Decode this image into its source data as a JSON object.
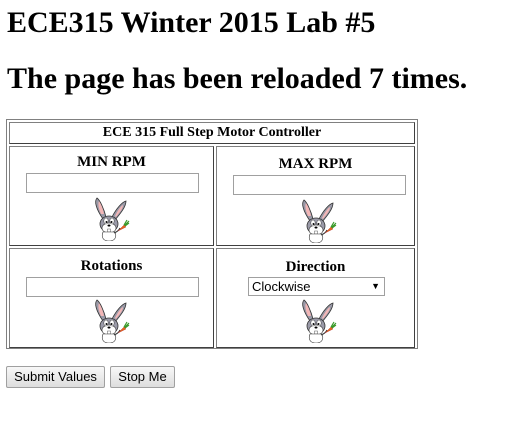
{
  "headings": {
    "lab_title": "ECE315 Winter 2015 Lab #5",
    "reload_text": "The page has been reloaded 7 times."
  },
  "controller": {
    "title": "ECE 315 Full Step Motor Controller",
    "min_rpm": {
      "label": "MIN RPM",
      "value": ""
    },
    "max_rpm": {
      "label": "MAX RPM",
      "value": ""
    },
    "rotations": {
      "label": "Rotations",
      "value": ""
    },
    "direction": {
      "label": "Direction",
      "selected": "Clockwise"
    },
    "image_icon": "bugs-bunny-icon"
  },
  "buttons": {
    "submit": "Submit Values",
    "stop": "Stop Me"
  },
  "colors": {
    "bunny_gray": "#9a9aa8",
    "carrot_orange": "#e8641b",
    "carrot_green": "#3a9a2a"
  }
}
